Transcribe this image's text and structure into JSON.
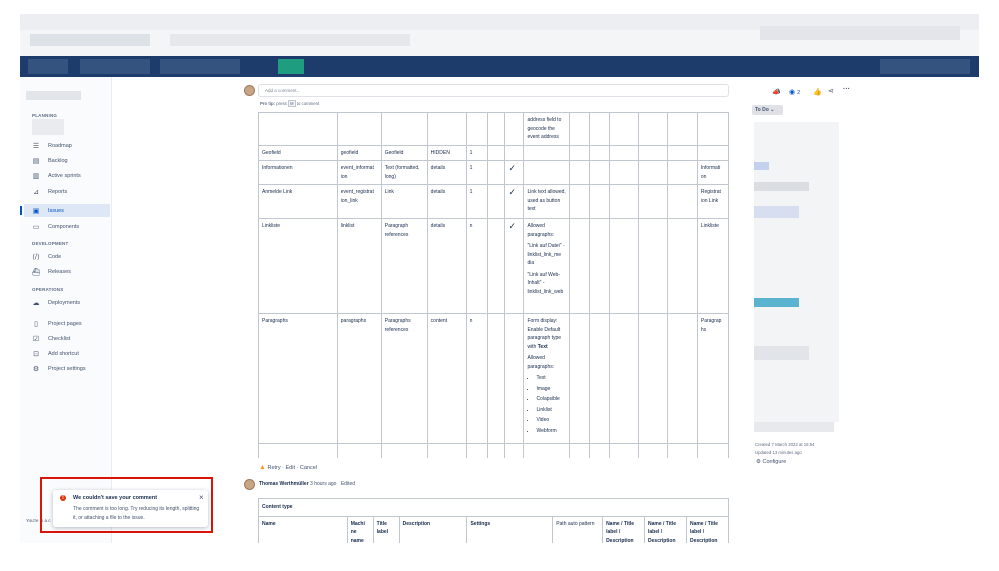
{
  "sidebar": {
    "planning_label": "PLANNING",
    "items": [
      {
        "label": "Roadmap",
        "icon": "roadmap-icon"
      },
      {
        "label": "Backlog",
        "icon": "backlog-icon"
      },
      {
        "label": "Active sprints",
        "icon": "board-icon"
      },
      {
        "label": "Reports",
        "icon": "chart-icon"
      },
      {
        "label": "Issues",
        "icon": "issues-icon"
      },
      {
        "label": "Components",
        "icon": "component-icon"
      }
    ],
    "development_label": "DEVELOPMENT",
    "dev_items": [
      {
        "label": "Code",
        "icon": "code-icon"
      },
      {
        "label": "Releases",
        "icon": "ship-icon"
      }
    ],
    "operations_label": "OPERATIONS",
    "ops_items": [
      {
        "label": "Deployments",
        "icon": "cloud-icon"
      }
    ],
    "other_items": [
      {
        "label": "Project pages",
        "icon": "page-icon"
      },
      {
        "label": "Checklist",
        "icon": "checklist-icon"
      },
      {
        "label": "Add shortcut",
        "icon": "shortcut-icon"
      },
      {
        "label": "Project settings",
        "icon": "gear-icon"
      }
    ],
    "footer_text": "You're in a c"
  },
  "comment": {
    "placeholder": "Add a comment...",
    "protip_bold": "Pro tip:",
    "protip_text": "press",
    "protip_key": "M",
    "protip_end": "to comment"
  },
  "table1": {
    "rows": [
      {
        "c1": "",
        "c2": "",
        "c3": "",
        "c4": "",
        "c5": "",
        "check": false,
        "desc": [
          "address field to geocode the event address"
        ],
        "last": ""
      },
      {
        "c1": "Geofield",
        "c2": "geofield",
        "c3": "Geofield",
        "c4": "HIDDEN",
        "c5": "1",
        "check": false,
        "desc": [],
        "last": ""
      },
      {
        "c1": "Informationen",
        "c2": "event_informat ion",
        "c3": "Text (formatted, long)",
        "c4": "details",
        "c5": "1",
        "check": true,
        "desc": [],
        "last": "Informati on"
      },
      {
        "c1": "Anmelde Link",
        "c2": "event_registrat ion_link",
        "c3": "Link",
        "c4": "details",
        "c5": "1",
        "check": true,
        "desc": [
          "Link text allowed, used as button text"
        ],
        "last": "Registrat ion Link"
      },
      {
        "c1": "Linkliste",
        "c2": "linklist",
        "c3": "Paragraph references",
        "c4": "details",
        "c5": "n",
        "check": true,
        "desc": [
          "Allowed paragraphs:",
          "\"Link auf Datei\" - linklist_link_me dia",
          "\"Link auf Web-Inhalt\" - linklist_link_web"
        ],
        "last": "Linkliste"
      },
      {
        "c1": "Paragraphs",
        "c2": "paragraphs",
        "c3": "Paragraphs references",
        "c4": "content",
        "c5": "n",
        "check": false,
        "desc": [
          "Form display: Enable Default paragraph type with",
          "Allowed paragraphs:"
        ],
        "desc_bold": "Text",
        "list": [
          "Text",
          "Image",
          "Colapsible",
          "Linklist",
          "Video",
          "Webform"
        ],
        "last": "Paragrap hs"
      }
    ]
  },
  "error_actions": {
    "retry": "Retry",
    "edit": "Edit",
    "cancel": "Cancel",
    "sep": "·"
  },
  "comment_author": {
    "name": "Thomas Werthmüller",
    "time": "3 hours ago",
    "edited": "Edited"
  },
  "table2": {
    "title": "Content type",
    "headers": [
      "Name",
      "Machi ne name",
      "Title label",
      "Description",
      "Settings",
      "Path auto pattern",
      "Name / Title label / Description",
      "Name / Title label / Description",
      "Name / Title label / Description"
    ]
  },
  "right_panel": {
    "watch_count": "2",
    "status": "To Do",
    "created": "Created 7 March 2022 at 15:54",
    "updated": "Updated 13 minutes ago",
    "configure": "Configure"
  },
  "toast": {
    "title": "We couldn't save your comment",
    "body": "The comment is too long. Try reducing its length, splitting it, or attaching a file to the issue.",
    "close": "×"
  },
  "colors": {
    "topbar": "#1d3c6b",
    "accent": "#0052cc",
    "error": "#de350b",
    "highlight_border": "#d9140a"
  }
}
